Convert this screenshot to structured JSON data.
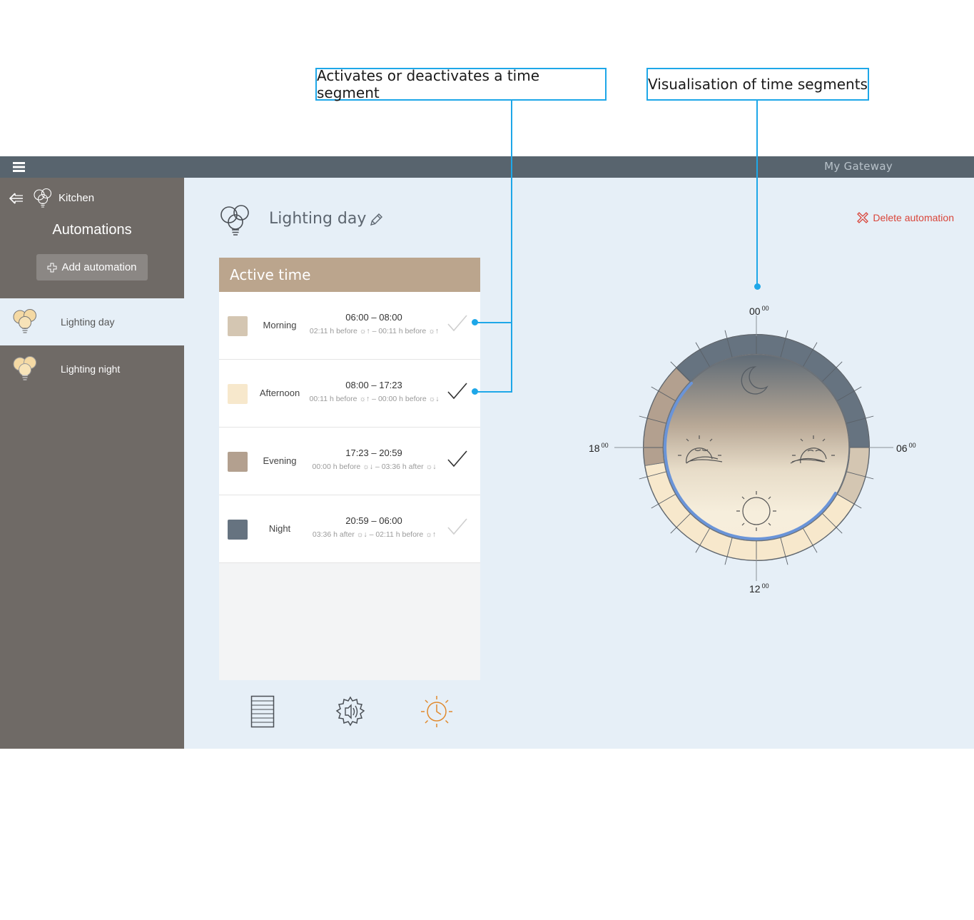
{
  "callouts": {
    "left": "Activates or deactivates a time segment",
    "right": "Visualisation of time segments"
  },
  "topbar": {
    "gateway": "My Gateway"
  },
  "sidebar": {
    "room": "Kitchen",
    "title": "Automations",
    "add_label": "Add automation",
    "items": [
      {
        "label": "Lighting day",
        "active": true
      },
      {
        "label": "Lighting night",
        "active": false
      }
    ]
  },
  "main": {
    "title": "Lighting day",
    "delete_label": "Delete automation",
    "panel_title": "Active time",
    "segments": [
      {
        "name": "Morning",
        "time": "06:00 – 08:00",
        "detail": "02:11 h before ☼↑ – 00:11 h before ☼↑",
        "color": "#d4c6b2",
        "checked": false
      },
      {
        "name": "Afternoon",
        "time": "08:00 – 17:23",
        "detail": "00:11 h before ☼↑ – 00:00 h before ☼↓",
        "color": "#f7e8cc",
        "checked": true
      },
      {
        "name": "Evening",
        "time": "17:23 – 20:59",
        "detail": "00:00 h before ☼↓ – 03:36 h after ☼↓",
        "color": "#b3a08f",
        "checked": true
      },
      {
        "name": "Night",
        "time": "20:59 – 06:00",
        "detail": "03:36 h after ☼↓ – 02:11 h before ☼↑",
        "color": "#667380",
        "checked": false
      }
    ]
  },
  "clock": {
    "top": "00",
    "right": "06",
    "bottom": "12",
    "left": "18",
    "sup": "00"
  },
  "colors": {
    "accent": "#1ea7e8",
    "topbar": "#58646e",
    "sidebar": "#6f6a66",
    "delete": "#d9453a",
    "timer_icon": "#e08a2e",
    "arc": "#6a94d8"
  }
}
